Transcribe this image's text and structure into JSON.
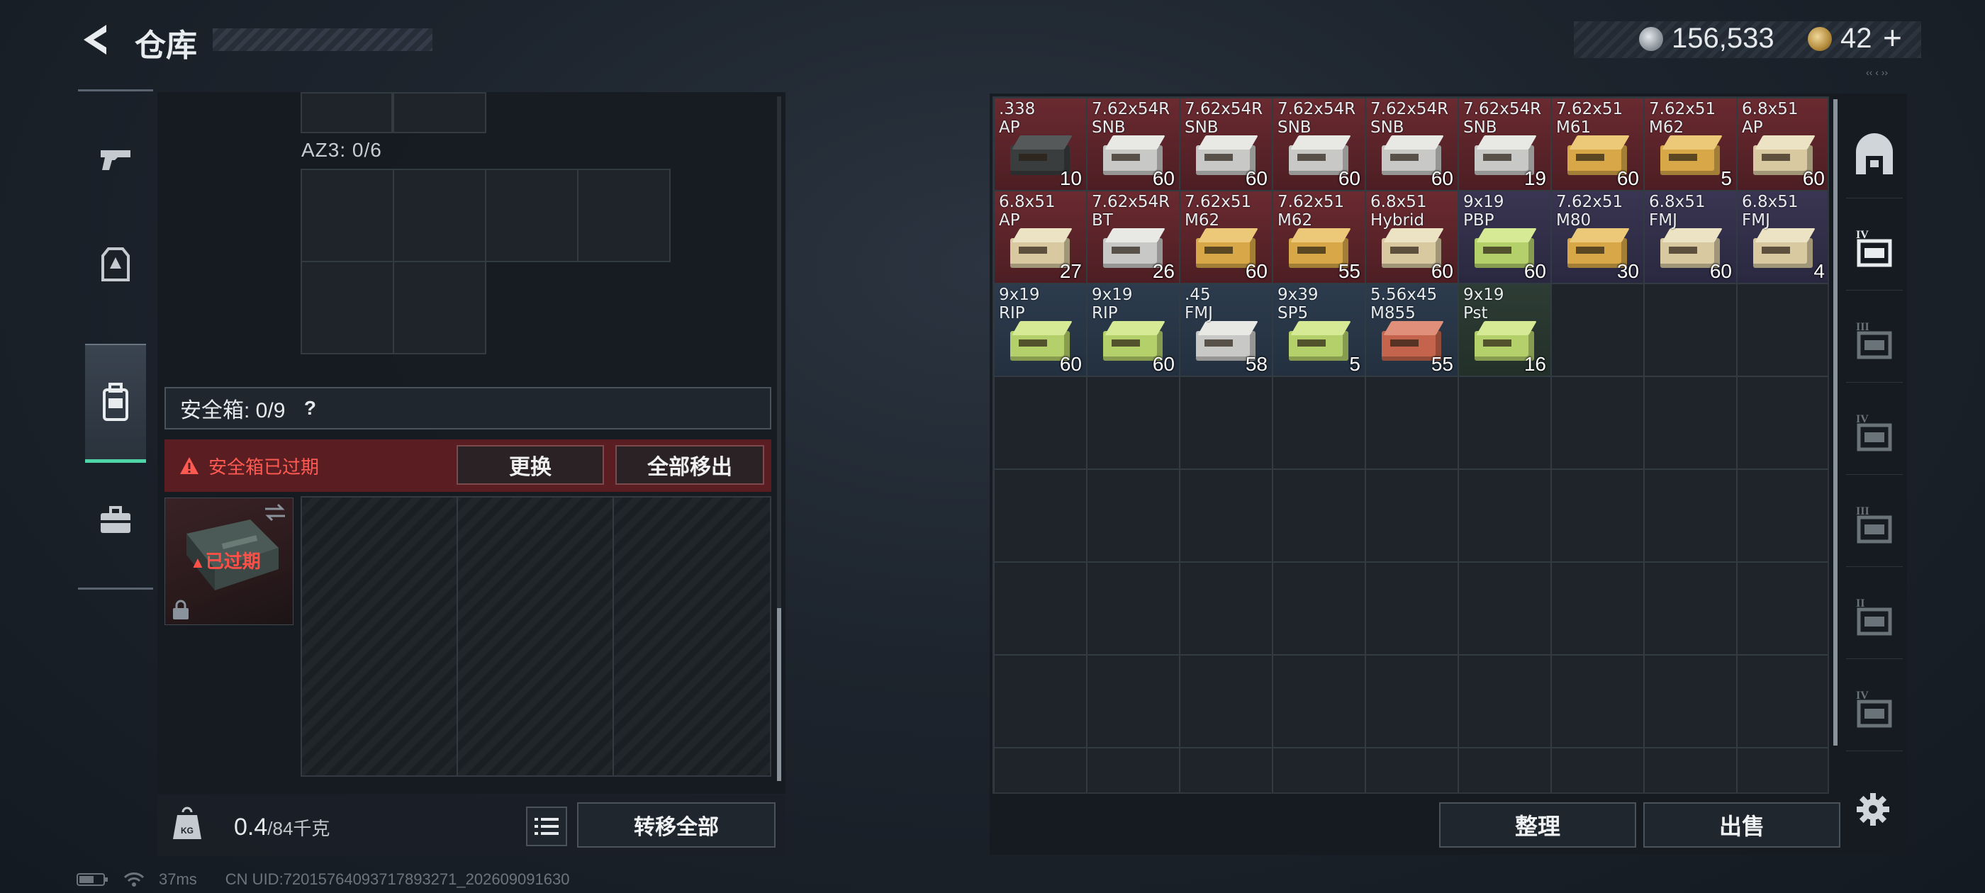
{
  "header": {
    "title": "仓库",
    "coins": "156,533",
    "tickets": "42",
    "tickets_plus": "+",
    "top_right_mark": "‹‹ ‹ ››"
  },
  "left_nav": {
    "items": [
      {
        "name": "weapon-tab",
        "icon": "pistol-icon",
        "active": false
      },
      {
        "name": "armor-tab",
        "icon": "vest-icon",
        "active": false
      },
      {
        "name": "container-tab",
        "icon": "backpack-icon",
        "active": true
      },
      {
        "name": "toolbox-tab",
        "icon": "toolbox-icon",
        "active": false
      }
    ]
  },
  "container": {
    "az3_label": "AZ3: 0/6",
    "safebox_label": "安全箱: 0/9",
    "safebox_help": "?",
    "expired_notice": "安全箱已过期",
    "replace_button": "更换",
    "remove_all_button": "全部移出",
    "expired_overlay": "已过期"
  },
  "footer_left": {
    "weight_current": "0.4",
    "weight_max": "/84千克",
    "weight_icon_label": "KG",
    "transfer_all_button": "转移全部"
  },
  "status_bar": {
    "latency": "37ms",
    "uid": "CN UID:720157640937178932​71_202609091630"
  },
  "stash": {
    "items": [
      {
        "name": ".338\nAP",
        "qty": "10",
        "bg": "red",
        "box": "#3a3d3e",
        "top": "#55595a"
      },
      {
        "name": "7.62x54R\nSNB",
        "qty": "60",
        "bg": "red",
        "box": "#c8c9c6",
        "top": "#e8e8e4"
      },
      {
        "name": "7.62x54R\nSNB",
        "qty": "60",
        "bg": "red",
        "box": "#c8c9c6",
        "top": "#e8e8e4"
      },
      {
        "name": "7.62x54R\nSNB",
        "qty": "60",
        "bg": "red",
        "box": "#c8c9c6",
        "top": "#e8e8e4"
      },
      {
        "name": "7.62x54R\nSNB",
        "qty": "60",
        "bg": "red",
        "box": "#c8c9c6",
        "top": "#e8e8e4"
      },
      {
        "name": "7.62x54R\nSNB",
        "qty": "19",
        "bg": "red",
        "box": "#c8c9c6",
        "top": "#e8e8e4"
      },
      {
        "name": "7.62x51\nM61",
        "qty": "60",
        "bg": "red",
        "box": "#d8a848",
        "top": "#ecc979"
      },
      {
        "name": "7.62x51\nM62",
        "qty": "5",
        "bg": "red",
        "box": "#d8a848",
        "top": "#ecc979"
      },
      {
        "name": "6.8x51\nAP",
        "qty": "60",
        "bg": "red",
        "box": "#d9c9a0",
        "top": "#ece2c4"
      },
      {
        "name": "6.8x51\nAP",
        "qty": "27",
        "bg": "red",
        "box": "#d9c9a0",
        "top": "#ece2c4"
      },
      {
        "name": "7.62x54R\nBT",
        "qty": "26",
        "bg": "red",
        "box": "#c8c9c6",
        "top": "#e8e8e4"
      },
      {
        "name": "7.62x51\nM62",
        "qty": "60",
        "bg": "red",
        "box": "#d8a848",
        "top": "#ecc979"
      },
      {
        "name": "7.62x51\nM62",
        "qty": "55",
        "bg": "red",
        "box": "#d8a848",
        "top": "#ecc979"
      },
      {
        "name": "6.8x51\nHybrid",
        "qty": "60",
        "bg": "red",
        "box": "#d9c9a0",
        "top": "#ece2c4"
      },
      {
        "name": "9x19\nPBP",
        "qty": "60",
        "bg": "purple",
        "box": "#b4d06a",
        "top": "#d6ea96"
      },
      {
        "name": "7.62x51\nM80",
        "qty": "30",
        "bg": "purple",
        "box": "#d8a848",
        "top": "#ecc979"
      },
      {
        "name": "6.8x51\nFMJ",
        "qty": "60",
        "bg": "purple",
        "box": "#d9c9a0",
        "top": "#ece2c4"
      },
      {
        "name": "6.8x51\nFMJ",
        "qty": "4",
        "bg": "purple",
        "box": "#d9c9a0",
        "top": "#ece2c4"
      },
      {
        "name": "9x19\nRIP",
        "qty": "60",
        "bg": "blue",
        "box": "#b4d06a",
        "top": "#d6ea96"
      },
      {
        "name": "9x19\nRIP",
        "qty": "60",
        "bg": "blue",
        "box": "#b4d06a",
        "top": "#d6ea96"
      },
      {
        "name": ".45\nFMJ",
        "qty": "58",
        "bg": "blue",
        "box": "#c8c9c6",
        "top": "#e8e8e4"
      },
      {
        "name": "9x39\nSP5",
        "qty": "5",
        "bg": "blue",
        "box": "#b4d06a",
        "top": "#d6ea96"
      },
      {
        "name": "5.56x45\nM855",
        "qty": "55",
        "bg": "blue",
        "box": "#c4644c",
        "top": "#e0907a"
      },
      {
        "name": "9x19\nPst",
        "qty": "16",
        "bg": "green",
        "box": "#b4d06a",
        "top": "#d6ea96"
      }
    ],
    "sort_button": "整理",
    "sell_button": "出售"
  },
  "right_tabs": [
    {
      "name": "all-tab",
      "label": "",
      "icon": "all-storage-icon"
    },
    {
      "name": "ammo-tab",
      "label": "IV",
      "icon": "ammo-crate-icon"
    },
    {
      "name": "weapon-case-tab",
      "label": "III",
      "icon": "weapon-case-icon"
    },
    {
      "name": "gear-case-tab",
      "label": "IV",
      "icon": "gear-case-icon"
    },
    {
      "name": "medical-case-tab",
      "label": "III",
      "icon": "medical-case-icon"
    },
    {
      "name": "misc-case-tab",
      "label": "II",
      "icon": "misc-case-icon"
    },
    {
      "name": "extra-case-tab",
      "label": "IV",
      "icon": "extra-case-icon"
    }
  ],
  "colors": {
    "accent": "#4fd6a8",
    "danger": "#ff5a52",
    "rarity_red": "#6a2a30",
    "rarity_purple": "#3a3552",
    "rarity_blue": "#2c3b4d",
    "rarity_green": "#2d3c34"
  }
}
